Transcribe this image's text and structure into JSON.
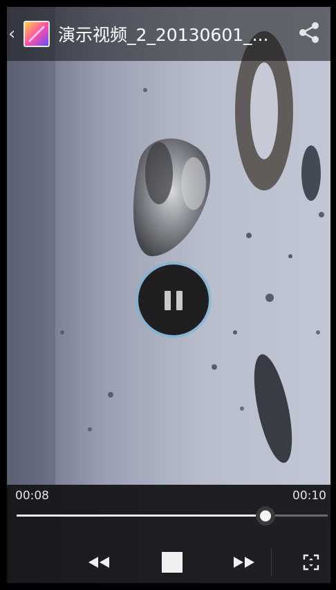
{
  "header": {
    "title": "演示视频_2_20130601_...",
    "back_icon": "chevron-left-icon",
    "app_icon": "gallery-icon",
    "share_icon": "share-icon"
  },
  "player": {
    "state_icon": "pause-icon",
    "current_time": "00:08",
    "total_time": "00:10",
    "progress": 0.8,
    "controls": [
      "rewind-icon",
      "stop-icon",
      "fast-forward-icon",
      "fullscreen-icon"
    ]
  },
  "colors": {
    "accent_glow": "#6eb4dc",
    "bar_bg": "#121216",
    "progress_fill": "#f2f2f2"
  }
}
